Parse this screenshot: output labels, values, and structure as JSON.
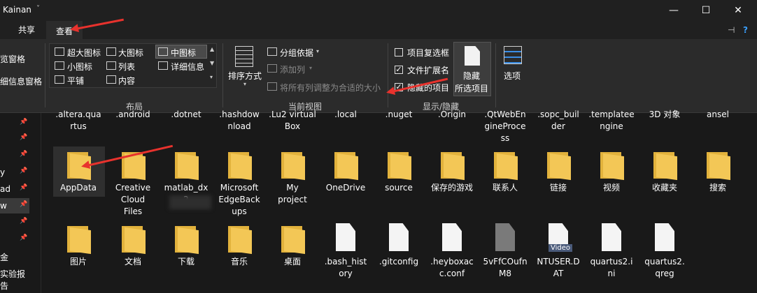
{
  "window": {
    "title": "Kainan"
  },
  "tabs": {
    "share": "共享",
    "view": "查看"
  },
  "ribbon": {
    "pane_nav_1": "览窗格",
    "pane_nav_2": "细信息窗格",
    "layout": {
      "items": [
        "超大图标",
        "大图标",
        "中图标",
        "小图标",
        "列表",
        "详细信息",
        "平铺",
        "内容"
      ],
      "group": "布局"
    },
    "current_view": {
      "sort": "排序方式",
      "groupby": "分组依据",
      "addcol": "添加列",
      "fitcols": "将所有列调整为合适的大小",
      "group": "当前视图"
    },
    "show_hide": {
      "checkboxes": [
        {
          "label": "项目复选框",
          "checked": false
        },
        {
          "label": "文件扩展名",
          "checked": true
        },
        {
          "label": "隐藏的项目",
          "checked": true
        }
      ],
      "hide_selected_1": "隐藏",
      "hide_selected_2": "所选项目",
      "group": "显示/隐藏"
    },
    "options": "选项"
  },
  "sidebar": {
    "items": [
      "y",
      "ad",
      "w",
      "金",
      "实验报告"
    ]
  },
  "files": {
    "row0": [
      {
        "l1": ".altera.qua",
        "l2": "rtus"
      },
      {
        "l1": ".android",
        "l2": ""
      },
      {
        "l1": ".dotnet",
        "l2": ""
      },
      {
        "l1": ".hashdow",
        "l2": "nload"
      },
      {
        "l1": ".Lu2 virtual",
        "l2": "Box"
      },
      {
        "l1": ".local",
        "l2": ""
      },
      {
        "l1": ".nuget",
        "l2": ""
      },
      {
        "l1": ".Origin",
        "l2": ""
      },
      {
        "l1": ".QtWebEn",
        "l2": "gineProce",
        "l3": "ss"
      },
      {
        "l1": ".sopc_buil",
        "l2": "der"
      },
      {
        "l1": ".templatee",
        "l2": "ngine"
      },
      {
        "l1": "3D 对象",
        "l2": ""
      },
      {
        "l1": "ansel",
        "l2": ""
      }
    ],
    "row1": [
      {
        "l1": "AppData",
        "l2": ""
      },
      {
        "l1": "Creative",
        "l2": "Cloud",
        "l3": "Files"
      },
      {
        "l1": "matlab_dx",
        "l2": "2"
      },
      {
        "l1": "Microsoft",
        "l2": "EdgeBack",
        "l3": "ups"
      },
      {
        "l1": "My",
        "l2": "project"
      },
      {
        "l1": "OneDrive",
        "l2": ""
      },
      {
        "l1": "source",
        "l2": ""
      },
      {
        "l1": "保存的游戏",
        "l2": ""
      },
      {
        "l1": "联系人",
        "l2": ""
      },
      {
        "l1": "链接",
        "l2": ""
      },
      {
        "l1": "视频",
        "l2": ""
      },
      {
        "l1": "收藏夹",
        "l2": ""
      },
      {
        "l1": "搜索",
        "l2": ""
      }
    ],
    "row2": [
      {
        "l1": "图片",
        "l2": ""
      },
      {
        "l1": "文档",
        "l2": ""
      },
      {
        "l1": "下载",
        "l2": ""
      },
      {
        "l1": "音乐",
        "l2": ""
      },
      {
        "l1": "桌面",
        "l2": ""
      },
      {
        "l1": ".bash_hist",
        "l2": "ory"
      },
      {
        "l1": ".gitconfig",
        "l2": ""
      },
      {
        "l1": ".heyboxac",
        "l2": "c.conf"
      },
      {
        "l1": "5vFfCOufn",
        "l2": "M8"
      },
      {
        "l1": "NTUSER.D",
        "l2": "AT"
      },
      {
        "l1": "quartus2.i",
        "l2": "ni"
      },
      {
        "l1": "quartus2.",
        "l2": "qreg"
      }
    ],
    "video_badge": "Video"
  },
  "colors": {
    "accent": "#e8322d",
    "folder": "#f3c756",
    "folder_dark": "#e2b23c"
  }
}
